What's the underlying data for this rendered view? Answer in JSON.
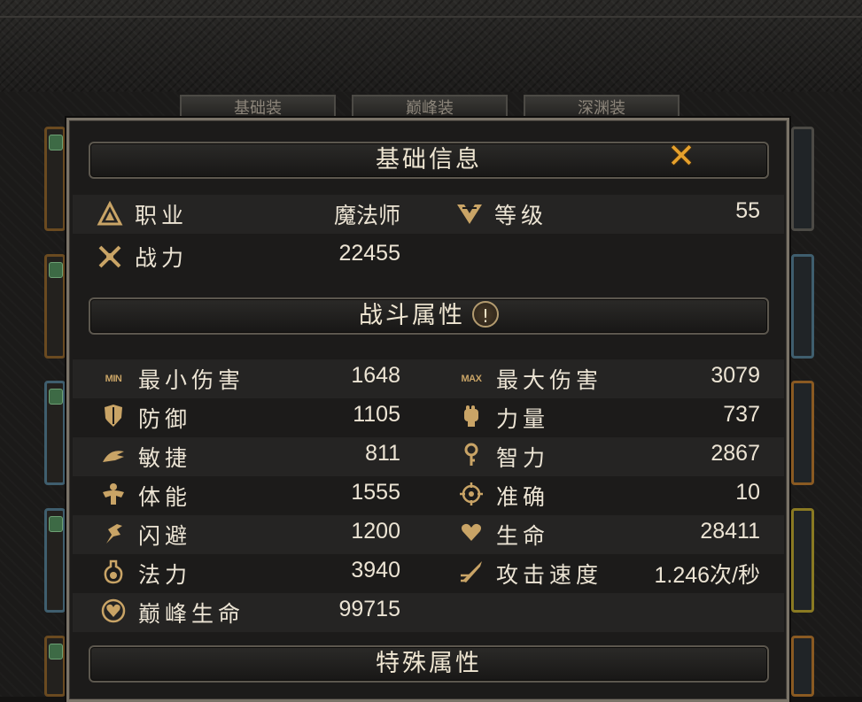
{
  "background": {
    "tabs": [
      "基础装",
      "巅峰装",
      "深渊装"
    ]
  },
  "panel": {
    "basic_info": {
      "title": "基础信息",
      "close_icon": "close-x-icon",
      "rows": [
        {
          "label": "职业",
          "value": "魔法师",
          "icon": "class-icon"
        },
        {
          "label": "等级",
          "value": "55",
          "icon": "level-icon"
        },
        {
          "label": "战力",
          "value": "22455",
          "icon": "power-icon"
        }
      ]
    },
    "combat_attributes": {
      "title": "战斗属性",
      "info_glyph": "!",
      "stats": [
        {
          "label": "最小伤害",
          "value": "1648",
          "icon": "min-damage-icon",
          "tag": "MIN"
        },
        {
          "label": "最大伤害",
          "value": "3079",
          "icon": "max-damage-icon",
          "tag": "MAX"
        },
        {
          "label": "防御",
          "value": "1105",
          "icon": "defense-icon"
        },
        {
          "label": "力量",
          "value": "737",
          "icon": "strength-icon"
        },
        {
          "label": "敏捷",
          "value": "811",
          "icon": "agility-icon"
        },
        {
          "label": "智力",
          "value": "2867",
          "icon": "intelligence-icon"
        },
        {
          "label": "体能",
          "value": "1555",
          "icon": "stamina-icon"
        },
        {
          "label": "准确",
          "value": "10",
          "icon": "accuracy-icon"
        },
        {
          "label": "闪避",
          "value": "1200",
          "icon": "dodge-icon"
        },
        {
          "label": "生命",
          "value": "28411",
          "icon": "life-icon"
        },
        {
          "label": "法力",
          "value": "3940",
          "icon": "mana-icon"
        },
        {
          "label": "攻击速度",
          "value": "1.246次/秒",
          "icon": "attack-speed-icon"
        },
        {
          "label": "巅峰生命",
          "value": "99715",
          "icon": "peak-life-icon"
        }
      ]
    },
    "special_attributes": {
      "title": "特殊属性"
    }
  },
  "colors": {
    "accent_gold": "#c9a466",
    "close_orange": "#e6a12c",
    "text": "#ece4d4"
  }
}
